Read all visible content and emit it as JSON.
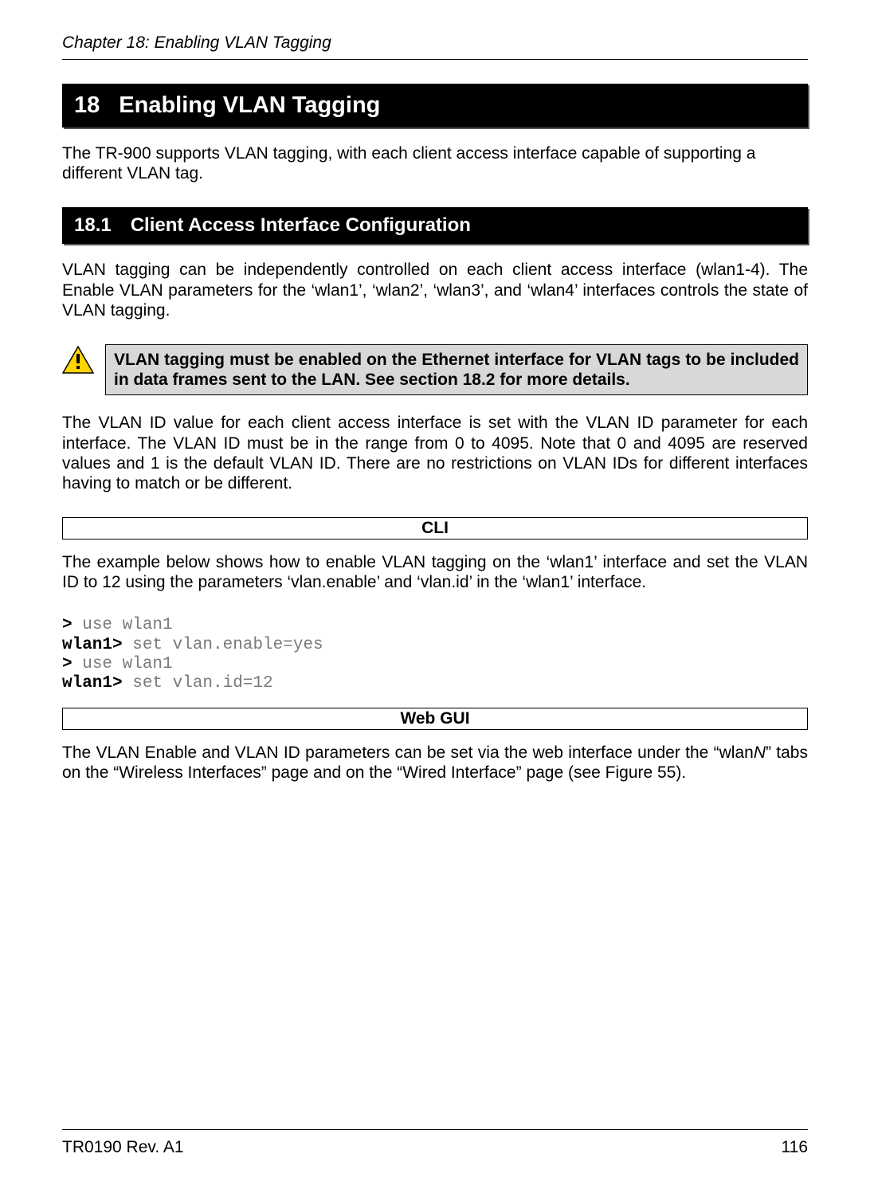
{
  "header": {
    "chapter_label": "Chapter 18: Enabling VLAN Tagging"
  },
  "chapter": {
    "number": "18",
    "title": "Enabling VLAN Tagging"
  },
  "intro": "The TR-900 supports VLAN tagging, with each client access interface capable of supporting a different VLAN tag.",
  "section": {
    "number": "18.1",
    "title": "Client Access Interface Configuration"
  },
  "section_body1": "VLAN tagging can be independently controlled on each client access interface (wlan1-4). The Enable VLAN parameters for the ‘wlan1’, ‘wlan2’, ‘wlan3’, and ‘wlan4’ interfaces controls the state of VLAN tagging.",
  "note": "VLAN tagging must be enabled on the Ethernet interface for VLAN tags to be included in data frames sent to the LAN. See section 18.2 for more details.",
  "section_body2": "The VLAN ID value for each client access interface is set with the VLAN ID parameter for each interface. The VLAN ID must be in the range from 0 to 4095. Note that 0 and 4095 are reserved values and 1 is the default VLAN ID. There are no restrictions on VLAN IDs for different interfaces having to match or be different.",
  "cli_heading": "CLI",
  "cli_intro": "The example below shows how to enable VLAN tagging on the ‘wlan1’ interface and set the VLAN ID to 12 using the parameters ‘vlan.enable’ and ‘vlan.id’ in the ‘wlan1’ interface.",
  "cli": {
    "p1": "> ",
    "c1": "use wlan1",
    "p2": "wlan1> ",
    "c2": "set vlan.enable=yes",
    "p3": "> ",
    "c3": "use wlan1",
    "p4": "wlan1> ",
    "c4": "set vlan.id=12"
  },
  "webgui_heading": "Web GUI",
  "webgui_body_pre": "The VLAN Enable and VLAN ID parameters can be set via the web interface under the “wlan",
  "webgui_body_n": "N",
  "webgui_body_post": "” tabs on the “Wireless Interfaces” page and on the “Wired Interface” page (see Figure 55).",
  "footer": {
    "left": "TR0190 Rev. A1",
    "right": "116"
  }
}
